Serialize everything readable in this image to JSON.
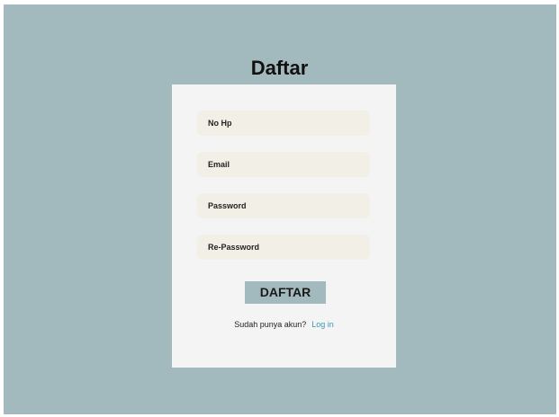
{
  "page": {
    "title": "Daftar"
  },
  "form": {
    "fields": [
      {
        "placeholder": "No Hp",
        "value": ""
      },
      {
        "placeholder": "Email",
        "value": ""
      },
      {
        "placeholder": "Password",
        "value": ""
      },
      {
        "placeholder": "Re-Password",
        "value": ""
      }
    ],
    "submit_label": "DAFTAR",
    "login_prompt": "Sudah punya akun?",
    "login_link": "Log in"
  },
  "colors": {
    "background": "#a2babd",
    "card": "#f4f4f4",
    "field": "#f2efe7",
    "button": "#a2babd",
    "link": "#3c96b4"
  }
}
